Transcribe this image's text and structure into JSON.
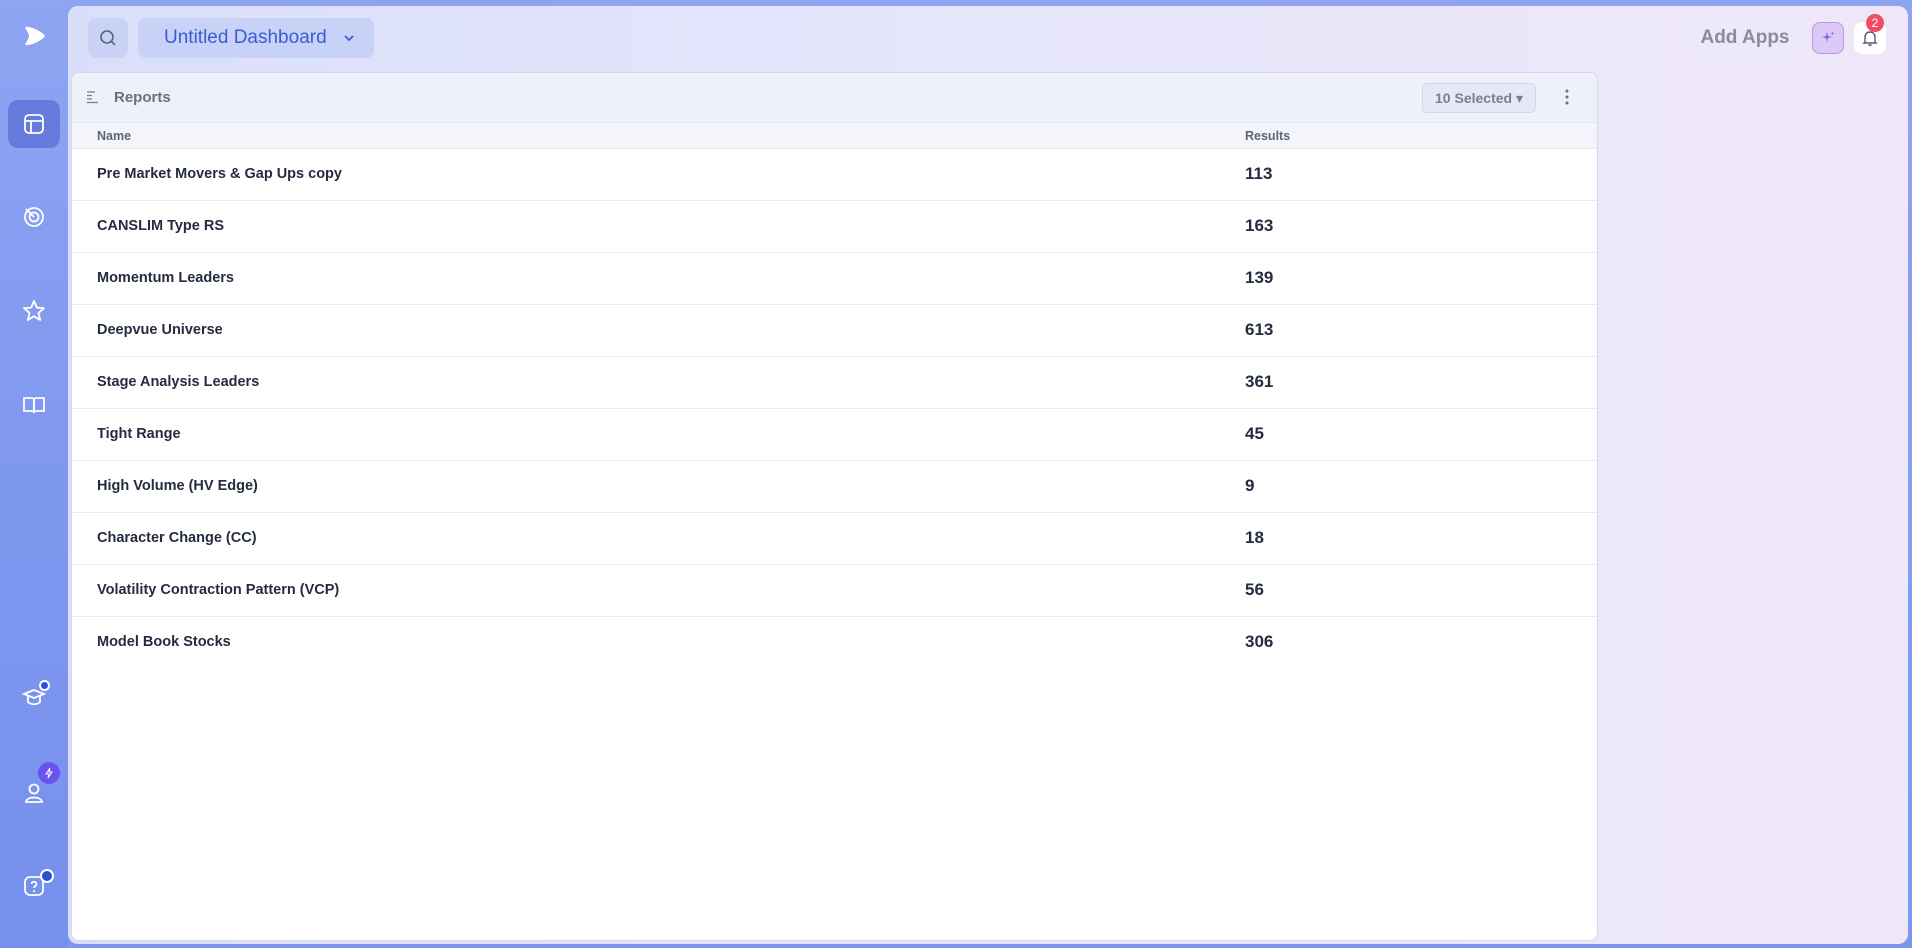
{
  "header": {
    "dashboard_title": "Untitled Dashboard",
    "add_apps_label": "Add Apps",
    "notification_count": "2"
  },
  "panel": {
    "title": "Reports",
    "selected_label": "10 Selected ▾"
  },
  "table": {
    "columns": [
      "Name",
      "Results"
    ],
    "rows": [
      {
        "name": "Pre Market Movers & Gap Ups copy",
        "results": "113"
      },
      {
        "name": "CANSLIM Type RS",
        "results": "163"
      },
      {
        "name": "Momentum Leaders",
        "results": "139"
      },
      {
        "name": "Deepvue Universe",
        "results": "613"
      },
      {
        "name": "Stage Analysis Leaders",
        "results": "361"
      },
      {
        "name": "Tight Range",
        "results": "45"
      },
      {
        "name": "High Volume (HV Edge)",
        "results": "9"
      },
      {
        "name": "Character Change (CC)",
        "results": "18"
      },
      {
        "name": "Volatility Contraction Pattern (VCP)",
        "results": "56"
      },
      {
        "name": "Model Book Stocks",
        "results": "306"
      }
    ]
  },
  "sidebar": {
    "items": [
      {
        "icon": "logo-icon"
      },
      {
        "icon": "dashboard-icon",
        "active": true
      },
      {
        "icon": "radar-icon"
      },
      {
        "icon": "star-icon"
      },
      {
        "icon": "book-icon"
      },
      {
        "icon": "graduation-cap-icon"
      },
      {
        "icon": "user-icon"
      },
      {
        "icon": "help-icon"
      }
    ]
  },
  "colors": {
    "accent": "#3b5bd6",
    "badge": "#ef4f64",
    "rail": "#8199ef"
  }
}
